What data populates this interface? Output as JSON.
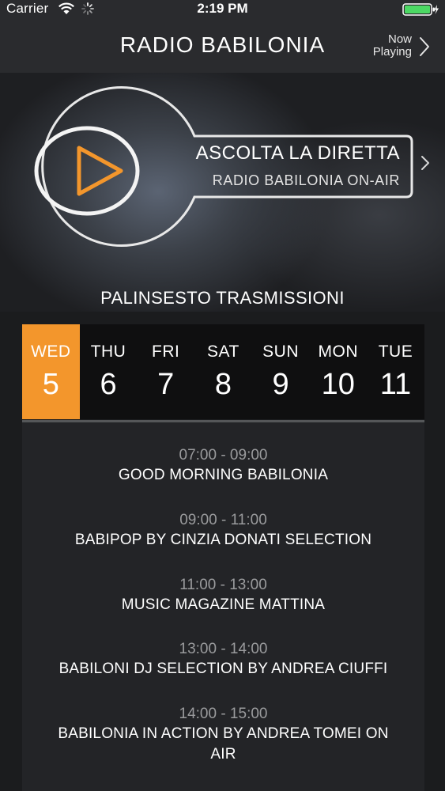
{
  "status_bar": {
    "carrier": "Carrier",
    "time": "2:19 PM"
  },
  "nav": {
    "title": "RADIO BABILONIA",
    "now_playing_line1": "Now",
    "now_playing_line2": "Playing",
    "chevron_icon": "chevron-right-icon"
  },
  "hero": {
    "listen_title": "ASCOLTA LA DIRETTA",
    "listen_subtitle": "RADIO BABILONIA ON-AIR",
    "play_icon": "play-icon",
    "accent_color": "#f3962c"
  },
  "schedule": {
    "title": "PALINSESTO TRASMISSIONI",
    "days": [
      {
        "name": "WED",
        "number": "5",
        "active": true
      },
      {
        "name": "THU",
        "number": "6",
        "active": false
      },
      {
        "name": "FRI",
        "number": "7",
        "active": false
      },
      {
        "name": "SAT",
        "number": "8",
        "active": false
      },
      {
        "name": "SUN",
        "number": "9",
        "active": false
      },
      {
        "name": "MON",
        "number": "10",
        "active": false
      },
      {
        "name": "TUE",
        "number": "11",
        "active": false
      }
    ],
    "programs": [
      {
        "time": "07:00 - 09:00",
        "name": "GOOD MORNING BABILONIA"
      },
      {
        "time": "09:00 - 11:00",
        "name": "BABIPOP BY CINZIA DONATI SELECTION"
      },
      {
        "time": "11:00 - 13:00",
        "name": "MUSIC MAGAZINE MATTINA"
      },
      {
        "time": "13:00 - 14:00",
        "name": "BABILONI DJ SELECTION BY ANDREA CIUFFI"
      },
      {
        "time": "14:00 - 15:00",
        "name": "BABILONIA IN ACTION BY ANDREA TOMEI ON AIR"
      }
    ]
  }
}
